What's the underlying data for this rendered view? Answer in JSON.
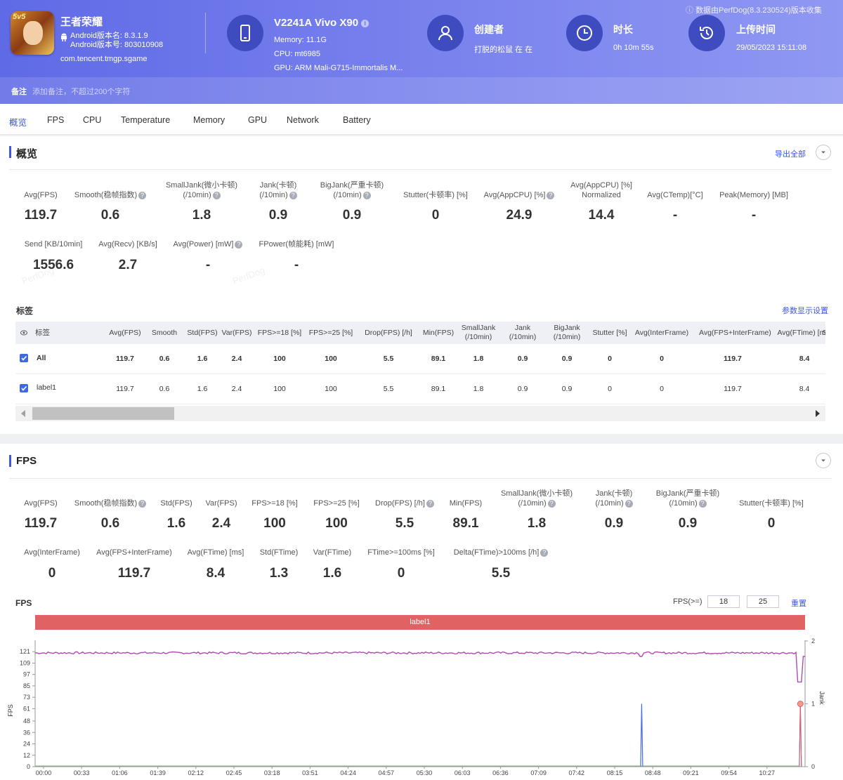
{
  "header": {
    "app_name": "王者荣耀",
    "app_icon_badge": "5v5",
    "android_version_name": "Android版本名: 8.3.1.9",
    "android_version_code": "Android版本号: 803010908",
    "package": "com.tencent.tmgp.sgame",
    "device_name": "V2241A Vivo X90",
    "memory": "Memory: 11.1G",
    "cpu": "CPU: mt6985",
    "gpu": "GPU: ARM Mali-G715-Immortalis M...",
    "creator_title": "创建者",
    "creator_value": "打脱的松鼠 在 在",
    "duration_title": "时长",
    "duration_value": "0h 10m 55s",
    "upload_title": "上传时间",
    "upload_value": "29/05/2023 15:11:08",
    "source_note": "数据由PerfDog(8.3.230524)版本收集",
    "note_label": "备注",
    "note_placeholder": "添加备注，不超过200个字符"
  },
  "tabs": [
    "概览",
    "FPS",
    "CPU",
    "Temperature",
    "Memory",
    "GPU",
    "Network",
    "Battery"
  ],
  "overview": {
    "title": "概览",
    "export_label": "导出全部",
    "metrics_row1": [
      {
        "label": "Avg(FPS)",
        "value": "119.7"
      },
      {
        "label": "Smooth(稳帧指数)",
        "value": "0.6"
      },
      {
        "label": "SmallJank(微小卡顿)",
        "label2": "(/10min)",
        "value": "1.8"
      },
      {
        "label": "Jank(卡顿)",
        "label2": "(/10min)",
        "value": "0.9"
      },
      {
        "label": "BigJank(严重卡顿)",
        "label2": "(/10min)",
        "value": "0.9"
      },
      {
        "label": "Stutter(卡顿率) [%]",
        "value": "0"
      },
      {
        "label": "Avg(AppCPU) [%]",
        "value": "24.9"
      },
      {
        "label": "Avg(AppCPU) [%]",
        "label2": "Normalized",
        "value": "14.4"
      },
      {
        "label": "Avg(CTemp)[°C]",
        "value": "-"
      },
      {
        "label": "Peak(Memory) [MB]",
        "value": "-"
      }
    ],
    "metrics_row2": [
      {
        "label": "Send [KB/10min]",
        "value": "1556.6"
      },
      {
        "label": "Avg(Recv) [KB/s]",
        "value": "2.7"
      },
      {
        "label": "Avg(Power) [mW]",
        "value": "-"
      },
      {
        "label": "FPower(帧能耗) [mW]",
        "value": "-"
      }
    ],
    "tags_title": "标签",
    "param_settings": "参数显示设置",
    "table_headers": [
      "标签",
      "Avg(FPS)",
      "Smooth",
      "Std(FPS)",
      "Var(FPS)",
      "FPS>=18 [%]",
      "FPS>=25 [%]",
      "Drop(FPS) [/h]",
      "Min(FPS)",
      "SmallJank|(/10min)",
      "Jank|(/10min)",
      "BigJank|(/10min)",
      "Stutter [%]",
      "Avg(InterFrame)",
      "Avg(FPS+InterFrame)",
      "Avg(FTime) [ms]",
      "S"
    ],
    "table_rows": [
      {
        "label": "All",
        "cells": [
          "119.7",
          "0.6",
          "1.6",
          "2.4",
          "100",
          "100",
          "5.5",
          "89.1",
          "1.8",
          "0.9",
          "0.9",
          "0",
          "0",
          "119.7",
          "8.4"
        ]
      },
      {
        "label": "label1",
        "cells": [
          "119.7",
          "0.6",
          "1.6",
          "2.4",
          "100",
          "100",
          "5.5",
          "89.1",
          "1.8",
          "0.9",
          "0.9",
          "0",
          "0",
          "119.7",
          "8.4"
        ]
      }
    ]
  },
  "fps_section": {
    "title": "FPS",
    "metrics_row1": [
      {
        "label": "Avg(FPS)",
        "value": "119.7"
      },
      {
        "label": "Smooth(稳帧指数)",
        "value": "0.6"
      },
      {
        "label": "Std(FPS)",
        "value": "1.6"
      },
      {
        "label": "Var(FPS)",
        "value": "2.4"
      },
      {
        "label": "FPS>=18 [%]",
        "value": "100"
      },
      {
        "label": "FPS>=25 [%]",
        "value": "100"
      },
      {
        "label": "Drop(FPS) [/h]",
        "value": "5.5"
      },
      {
        "label": "Min(FPS)",
        "value": "89.1"
      },
      {
        "label": "SmallJank(微小卡顿)",
        "label2": "(/10min)",
        "value": "1.8"
      },
      {
        "label": "Jank(卡顿)",
        "label2": "(/10min)",
        "value": "0.9"
      },
      {
        "label": "BigJank(严重卡顿)",
        "label2": "(/10min)",
        "value": "0.9"
      },
      {
        "label": "Stutter(卡顿率) [%]",
        "value": "0"
      }
    ],
    "metrics_row2": [
      {
        "label": "Avg(InterFrame)",
        "value": "0"
      },
      {
        "label": "Avg(FPS+InterFrame)",
        "value": "119.7"
      },
      {
        "label": "Avg(FTime) [ms]",
        "value": "8.4"
      },
      {
        "label": "Std(FTime)",
        "value": "1.3"
      },
      {
        "label": "Var(FTime)",
        "value": "1.6"
      },
      {
        "label": "FTime>=100ms [%]",
        "value": "0"
      },
      {
        "label": "Delta(FTime)>100ms [/h]",
        "value": "5.5"
      }
    ],
    "chart_title": "FPS",
    "threshold_label": "FPS(>=)",
    "threshold_1": "18",
    "threshold_2": "25",
    "reset_label": "重置",
    "band_label": "label1"
  },
  "chart_data": {
    "type": "line",
    "title": "FPS",
    "xlabel": "",
    "ylabel": "FPS",
    "y2label": "Jank",
    "x_ticks": [
      "00:00",
      "00:33",
      "01:06",
      "01:39",
      "02:12",
      "02:45",
      "03:18",
      "03:51",
      "04:24",
      "04:57",
      "05:30",
      "06:03",
      "06:36",
      "07:09",
      "07:42",
      "08:15",
      "08:48",
      "09:21",
      "09:54",
      "10:27"
    ],
    "y_ticks": [
      0,
      12,
      24,
      36,
      48,
      61,
      73,
      85,
      97,
      109,
      121
    ],
    "y2_ticks": [
      0,
      1,
      2
    ],
    "ylim": [
      0,
      130
    ],
    "y2lim": [
      0,
      2
    ],
    "duration_seconds": 655,
    "series": [
      {
        "name": "FPS",
        "color": "#b04ab0",
        "values": [
          119.7,
          119.5,
          120.1,
          119.8,
          120.0,
          119.6,
          119.9,
          120.2,
          119.7,
          119.8,
          120.0,
          119.4,
          119.9,
          120.1,
          119.6,
          119.8,
          116.0,
          119.7,
          120.0,
          119.9,
          89.1,
          119.5
        ]
      },
      {
        "name": "Jank",
        "color": "#4a6ae0",
        "spikes": [
          {
            "t": 516,
            "value": 1
          },
          {
            "t": 651,
            "value": 1
          }
        ]
      }
    ]
  }
}
